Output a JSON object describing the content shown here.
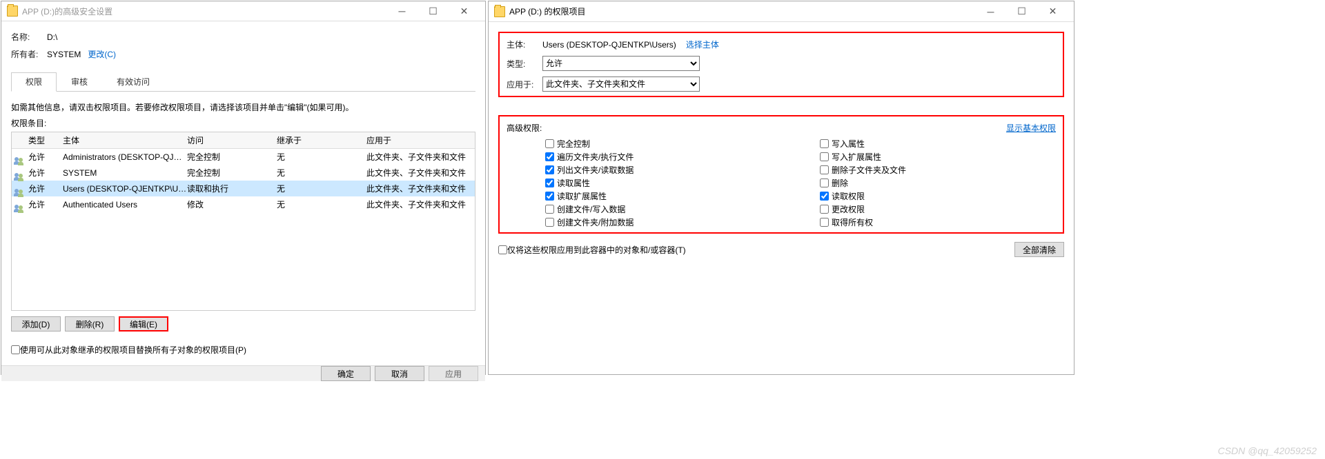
{
  "left": {
    "title": "APP (D:)的高级安全设置",
    "name_label": "名称:",
    "name_value": "D:\\",
    "owner_label": "所有者:",
    "owner_value": "SYSTEM",
    "change_link": "更改(C)",
    "tabs": {
      "perm": "权限",
      "audit": "审核",
      "eff": "有效访问"
    },
    "hint": "如需其他信息，请双击权限项目。若要修改权限项目，请选择该项目并单击\"编辑\"(如果可用)。",
    "list_label": "权限条目:",
    "cols": {
      "type": "类型",
      "principal": "主体",
      "access": "访问",
      "inherit": "继承于",
      "apply": "应用于"
    },
    "rows": [
      {
        "type": "允许",
        "principal": "Administrators (DESKTOP-QJEN...",
        "access": "完全控制",
        "inherit": "无",
        "apply": "此文件夹、子文件夹和文件"
      },
      {
        "type": "允许",
        "principal": "SYSTEM",
        "access": "完全控制",
        "inherit": "无",
        "apply": "此文件夹、子文件夹和文件"
      },
      {
        "type": "允许",
        "principal": "Users (DESKTOP-QJENTKP\\Users)",
        "access": "读取和执行",
        "inherit": "无",
        "apply": "此文件夹、子文件夹和文件"
      },
      {
        "type": "允许",
        "principal": "Authenticated Users",
        "access": "修改",
        "inherit": "无",
        "apply": "此文件夹、子文件夹和文件"
      }
    ],
    "buttons": {
      "add": "添加(D)",
      "remove": "删除(R)",
      "edit": "编辑(E)"
    },
    "replace_chk": "使用可从此对象继承的权限项目替换所有子对象的权限项目(P)",
    "footer": {
      "ok": "确定",
      "cancel": "取消",
      "apply": "应用"
    }
  },
  "right": {
    "title": "APP (D:) 的权限项目",
    "principal_label": "主体:",
    "principal_value": "Users (DESKTOP-QJENTKP\\Users)",
    "select_principal": "选择主体",
    "type_label": "类型:",
    "type_value": "允许",
    "applies_label": "应用于:",
    "applies_value": "此文件夹、子文件夹和文件",
    "adv_label": "高级权限:",
    "show_basic": "显示基本权限",
    "perms_left": [
      {
        "label": "完全控制",
        "checked": false
      },
      {
        "label": "遍历文件夹/执行文件",
        "checked": true
      },
      {
        "label": "列出文件夹/读取数据",
        "checked": true
      },
      {
        "label": "读取属性",
        "checked": true
      },
      {
        "label": "读取扩展属性",
        "checked": true
      },
      {
        "label": "创建文件/写入数据",
        "checked": false
      },
      {
        "label": "创建文件夹/附加数据",
        "checked": false
      }
    ],
    "perms_right": [
      {
        "label": "写入属性",
        "checked": false
      },
      {
        "label": "写入扩展属性",
        "checked": false
      },
      {
        "label": "删除子文件夹及文件",
        "checked": false
      },
      {
        "label": "删除",
        "checked": false
      },
      {
        "label": "读取权限",
        "checked": true
      },
      {
        "label": "更改权限",
        "checked": false
      },
      {
        "label": "取得所有权",
        "checked": false
      }
    ],
    "only_apply": "仅将这些权限应用到此容器中的对象和/或容器(T)",
    "clear_all": "全部清除"
  },
  "watermark": "CSDN @qq_42059252"
}
